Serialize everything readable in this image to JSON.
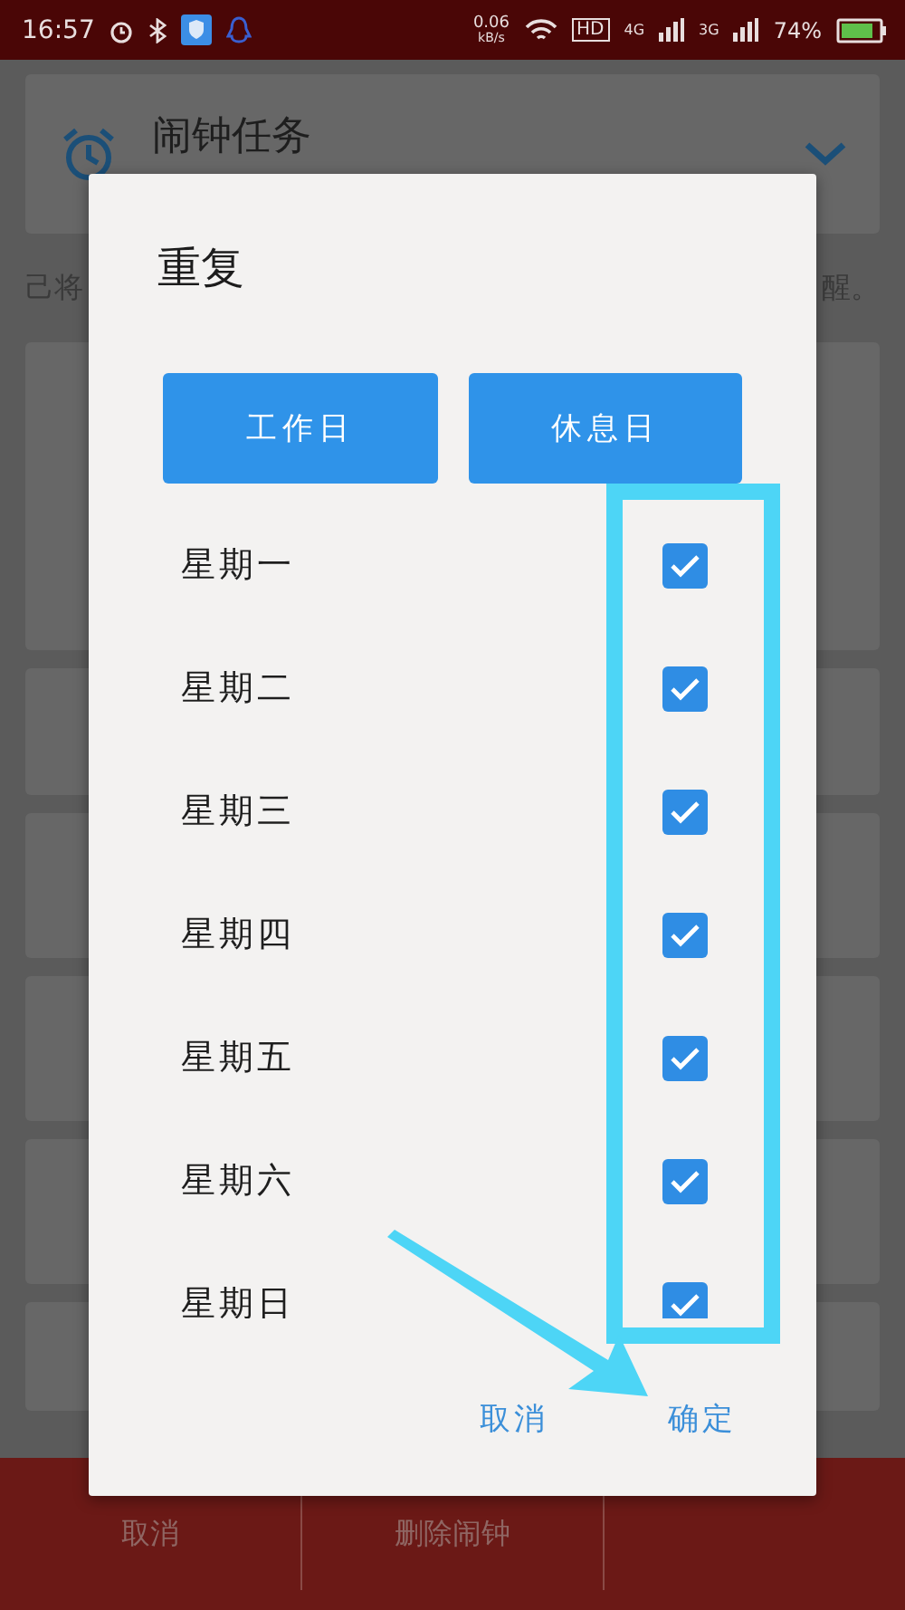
{
  "status_bar": {
    "time": "16:57",
    "network_speed": "0.06",
    "network_speed_unit": "kB/s",
    "hd_label": "HD",
    "signal_1_label": "4G",
    "signal_2_label": "3G",
    "battery": "74%"
  },
  "background": {
    "card_title": "闹钟任务",
    "note_left": "己将",
    "note_right": "醒。",
    "bottom_actions": [
      "取消",
      "删除闹钟"
    ]
  },
  "dialog": {
    "title": "重复",
    "presets": [
      "工作日",
      "休息日"
    ],
    "days": [
      {
        "label": "星期一",
        "checked": true
      },
      {
        "label": "星期二",
        "checked": true
      },
      {
        "label": "星期三",
        "checked": true
      },
      {
        "label": "星期四",
        "checked": true
      },
      {
        "label": "星期五",
        "checked": true
      },
      {
        "label": "星期六",
        "checked": true
      },
      {
        "label": "星期日",
        "checked": true
      }
    ],
    "actions": [
      "取消",
      "确定"
    ]
  }
}
